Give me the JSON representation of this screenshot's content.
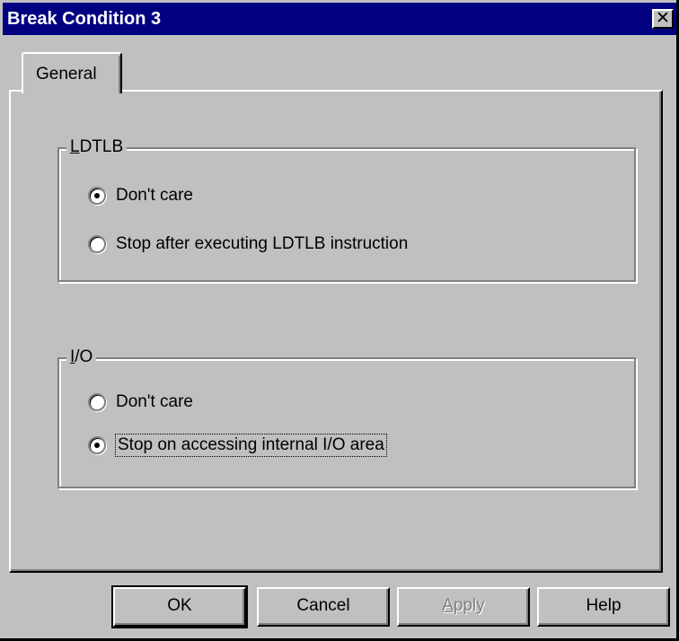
{
  "window": {
    "title": "Break Condition 3",
    "close_glyph": "✕"
  },
  "tabs": [
    {
      "label": "General",
      "selected": true
    }
  ],
  "groups": {
    "ldtlb": {
      "title_mnemonic": "L",
      "title_rest": "DTLB",
      "options": [
        {
          "label": "Don't care",
          "selected": true
        },
        {
          "label": "Stop after executing LDTLB instruction",
          "selected": false
        }
      ]
    },
    "io": {
      "title_mnemonic": "I",
      "title_rest": "/O",
      "options": [
        {
          "label": "Don't care",
          "selected": false
        },
        {
          "label": "Stop on accessing internal I/O area",
          "selected": true,
          "focused": true
        }
      ]
    }
  },
  "buttons": {
    "ok": "OK",
    "cancel": "Cancel",
    "apply_mnemonic": "A",
    "apply_rest": "pply",
    "apply_disabled": true,
    "help": "Help"
  },
  "colors": {
    "face": "#c0c0c0",
    "titlebar": "#000080",
    "shadow": "#808080",
    "highlight": "#ffffff"
  }
}
